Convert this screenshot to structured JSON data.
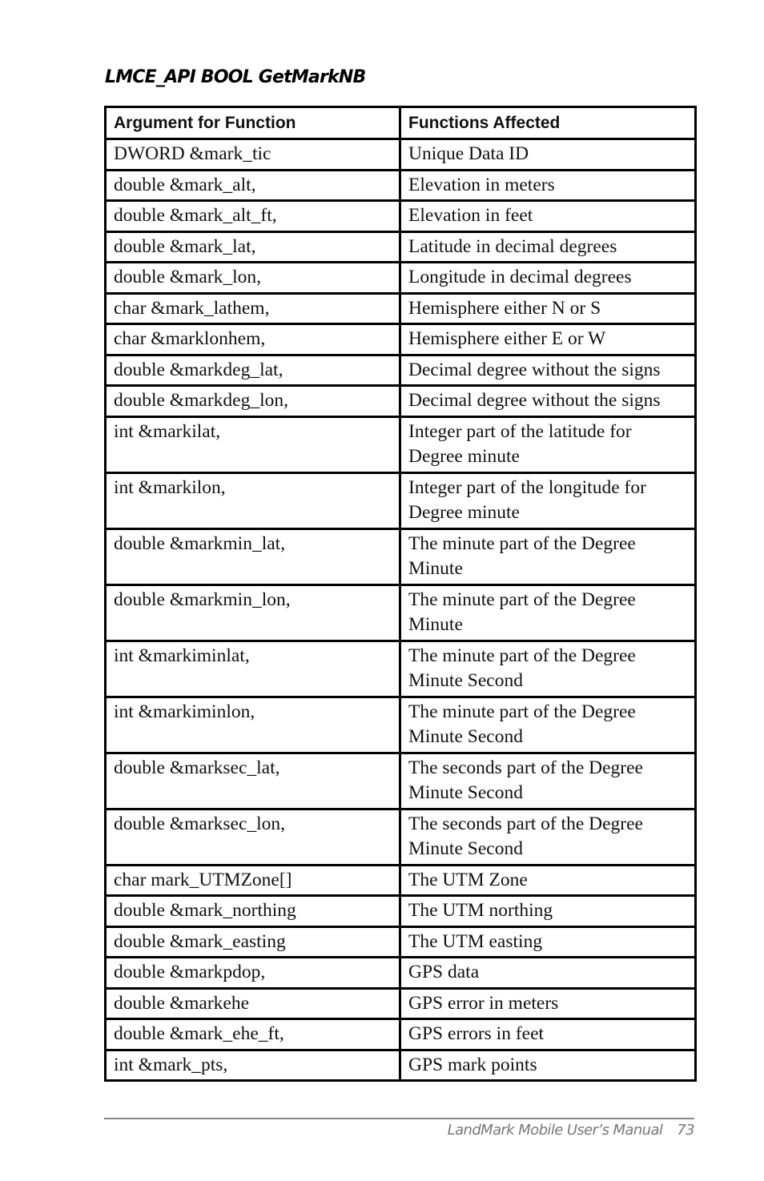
{
  "heading": "LMCE_API BOOL GetMarkNB",
  "table": {
    "headers": [
      "Argument for Function",
      "Functions Affected"
    ],
    "rows": [
      [
        "DWORD &mark_tic",
        "Unique Data ID"
      ],
      [
        "double &mark_alt,",
        "Elevation in meters"
      ],
      [
        "double &mark_alt_ft,",
        "Elevation in feet"
      ],
      [
        "double &mark_lat,",
        "Latitude in decimal degrees"
      ],
      [
        "double &mark_lon,",
        "Longitude in decimal degrees"
      ],
      [
        "char &mark_lathem,",
        "Hemisphere either N or S"
      ],
      [
        "char &marklonhem,",
        "Hemisphere either E or W"
      ],
      [
        "double &markdeg_lat,",
        "Decimal degree without the signs"
      ],
      [
        "double &markdeg_lon,",
        "Decimal degree without the signs"
      ],
      [
        "int &markilat,",
        "Integer part of the latitude for Degree minute"
      ],
      [
        "int &markilon,",
        "Integer part of the longitude for Degree minute"
      ],
      [
        "double &markmin_lat,",
        "The minute part of the Degree Minute"
      ],
      [
        "double &markmin_lon,",
        "The minute part of the Degree Minute"
      ],
      [
        "int &markiminlat,",
        "The minute part of the Degree Minute Second"
      ],
      [
        "int &markiminlon,",
        "The minute part of the Degree Minute Second"
      ],
      [
        "double &marksec_lat,",
        "The seconds part of the Degree Minute Second"
      ],
      [
        "double &marksec_lon,",
        "The seconds part of the Degree Minute Second"
      ],
      [
        "char mark_UTMZone[]",
        "The UTM Zone"
      ],
      [
        "double &mark_northing",
        "The UTM northing"
      ],
      [
        "double &mark_easting",
        "The UTM easting"
      ],
      [
        "double &markpdop,",
        "GPS data"
      ],
      [
        "double &markehe",
        "GPS error in meters"
      ],
      [
        "double &mark_ehe_ft,",
        "GPS errors in feet"
      ],
      [
        "int &mark_pts,",
        "GPS mark points"
      ]
    ]
  },
  "footer": {
    "title": "LandMark Mobile User’s Manual",
    "page_number": "73"
  }
}
